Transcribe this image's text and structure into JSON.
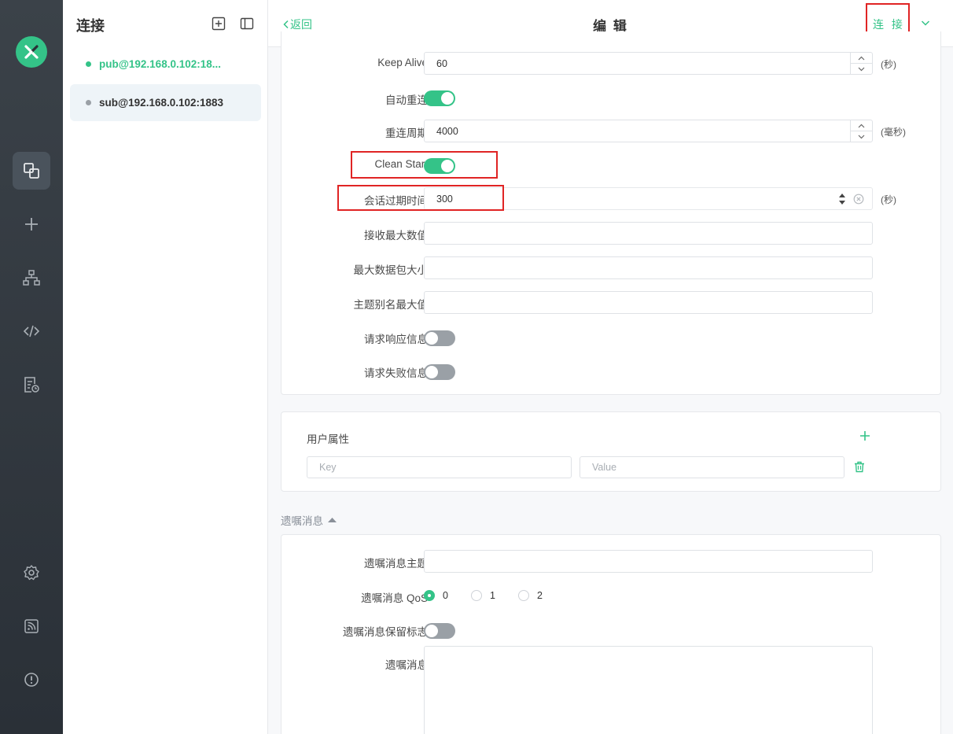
{
  "sidebar": {
    "title": "连接",
    "connections": [
      {
        "name": "pub@192.168.0.102:18...",
        "status_color": "#34c388",
        "selected": false
      },
      {
        "name": "sub@192.168.0.102:1883",
        "status_color": "#9aa0a6",
        "selected": true
      }
    ]
  },
  "rail": {
    "logo": "mqttx-logo",
    "items": [
      "connections-icon",
      "plus-icon",
      "topology-icon",
      "code-icon",
      "log-icon"
    ],
    "bottom_items": [
      "gear-icon",
      "rss-icon",
      "info-icon"
    ]
  },
  "header": {
    "back_label": "返回",
    "title": "编 辑",
    "connect_label": "连 接"
  },
  "advanced": {
    "keep_alive": {
      "label": "Keep Alive",
      "value": "60",
      "unit": "(秒)"
    },
    "auto_reconnect": {
      "label": "自动重连",
      "on": true
    },
    "reconnect_period": {
      "label": "重连周期",
      "value": "4000",
      "unit": "(毫秒)"
    },
    "clean_start": {
      "label": "Clean Start",
      "on": true
    },
    "session_expiry": {
      "label": "会话过期时间",
      "value": "300",
      "unit": "(秒)"
    },
    "receive_maximum": {
      "label": "接收最大数值",
      "value": ""
    },
    "max_packet_size": {
      "label": "最大数据包大小",
      "value": ""
    },
    "topic_alias_max": {
      "label": "主题别名最大值",
      "value": ""
    },
    "request_response_info": {
      "label": "请求响应信息",
      "on": false
    },
    "request_problem_info": {
      "label": "请求失败信息",
      "on": false
    }
  },
  "user_properties": {
    "title": "用户属性",
    "key_placeholder": "Key",
    "value_placeholder": "Value"
  },
  "last_will": {
    "section_title": "遗嘱消息",
    "topic": {
      "label": "遗嘱消息主题",
      "value": ""
    },
    "qos": {
      "label": "遗嘱消息 QoS",
      "options": [
        "0",
        "1",
        "2"
      ],
      "selected": "0"
    },
    "retain": {
      "label": "遗嘱消息保留标志",
      "on": false
    },
    "payload": {
      "label": "遗嘱消息",
      "value": ""
    }
  },
  "colors": {
    "accent": "#34c388",
    "highlight": "#e02424"
  }
}
